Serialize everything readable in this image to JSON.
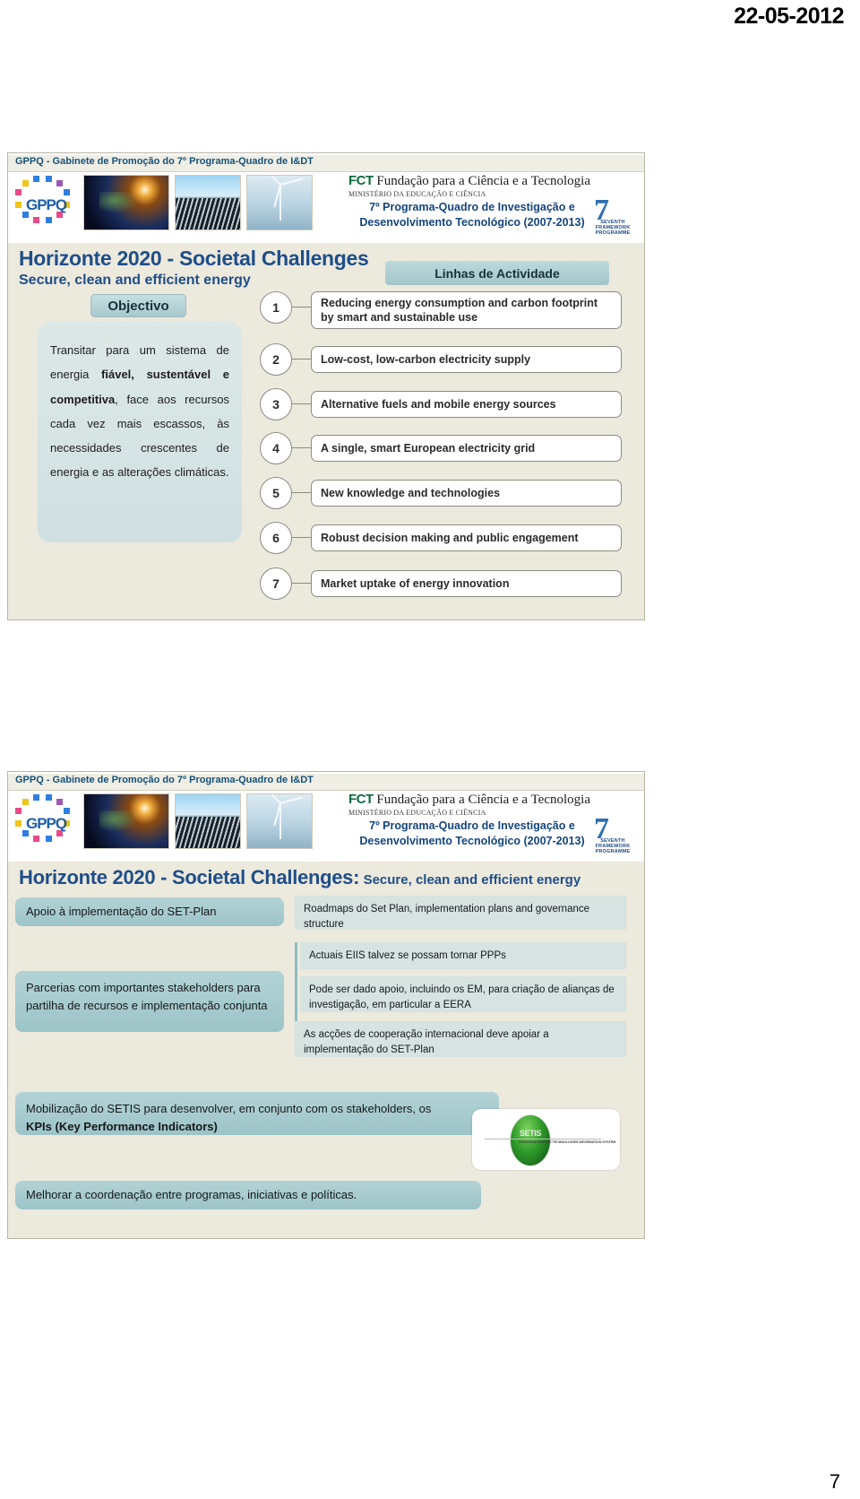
{
  "page": {
    "date": "22-05-2012",
    "number": "7"
  },
  "header": {
    "bar_text": "GPPQ - Gabinete de Promoção do 7º Programa-Quadro de I&DT",
    "gppq_word": "GPPQ",
    "fct_acronym": "FCT",
    "fct_name": "Fundação para a Ciência e a Tecnologia",
    "fct_ministry": "MINISTÉRIO DA EDUCAÇÃO E CIÊNCIA",
    "fp7_line1": "7º Programa-Quadro de Investigação e",
    "fp7_line2": "Desenvolvimento Tecnológico (2007-2013)",
    "fp7_logo_digit": "7",
    "fp7_logo_caption": "SEVENTH FRAMEWORK PROGRAMME",
    "photo_earth": "earth-photo",
    "photo_solar": "solar-panels-photo",
    "photo_wind": "wind-turbine-photo"
  },
  "slide1": {
    "title": "Horizonte 2020  - Societal Challenges",
    "subtitle": "Secure, clean and efficient energy",
    "objectivo_label": "Objectivo",
    "objectivo_text_pre": "Transitar para um sistema de energia ",
    "objectivo_text_bold1": "fiável, sustentável e competitiva",
    "objectivo_text_post": ", face aos recursos cada vez mais escassos, às necessidades crescentes de energia e as alterações climáticas.",
    "linhas_label": "Linhas de Actividade",
    "activities": [
      {
        "num": "1",
        "text": "Reducing energy consumption and carbon footprint by smart and sustainable use"
      },
      {
        "num": "2",
        "text": "Low-cost, low-carbon electricity supply"
      },
      {
        "num": "3",
        "text": "Alternative fuels and mobile energy sources"
      },
      {
        "num": "4",
        "text": "A single, smart European electricity grid"
      },
      {
        "num": "5",
        "text": "New knowledge and technologies"
      },
      {
        "num": "6",
        "text": "Robust decision making and public engagement"
      },
      {
        "num": "7",
        "text": "Market uptake of energy innovation"
      }
    ]
  },
  "slide2": {
    "title_big": "Horizonte 2020  - Societal Challenges:",
    "title_small": "Secure, clean and efficient energy",
    "left_box_1": "Apoio à implementação do SET-Plan",
    "left_box_2": "Parcerias com importantes stakeholders para partilha de recursos e implementação conjunta",
    "right_box_1": "Roadmaps do Set Plan, implementation plans and governance structure",
    "right_box_2": "Actuais EIIS talvez se possam tornar PPPs",
    "right_box_3": "Pode ser dado apoio, incluindo  os EM, para criação de alianças de investigação, em particular a EERA",
    "right_box_4": "As acções de cooperação internacional deve apoiar a implementação do SET-Plan",
    "wide_box_line1": "Mobilização do SETIS para desenvolver, em conjunto com os stakeholders, os",
    "wide_box_line2": "KPIs (Key Performance Indicators)",
    "bottom_box": "Melhorar a coordenação entre programas, iniciativas e políticas.",
    "setis_logo_word": "SETIS",
    "setis_logo_sub": "STRATEGIC ENERGY TECHNOLOGIES INFORMATION SYSTEM"
  },
  "colors": {
    "slide_bg": "#ece9dd",
    "title_blue": "#1f4e88",
    "teal": "#9cc4c8",
    "pale_teal": "#d6e3e0",
    "outline_gray": "#8d8b80"
  }
}
